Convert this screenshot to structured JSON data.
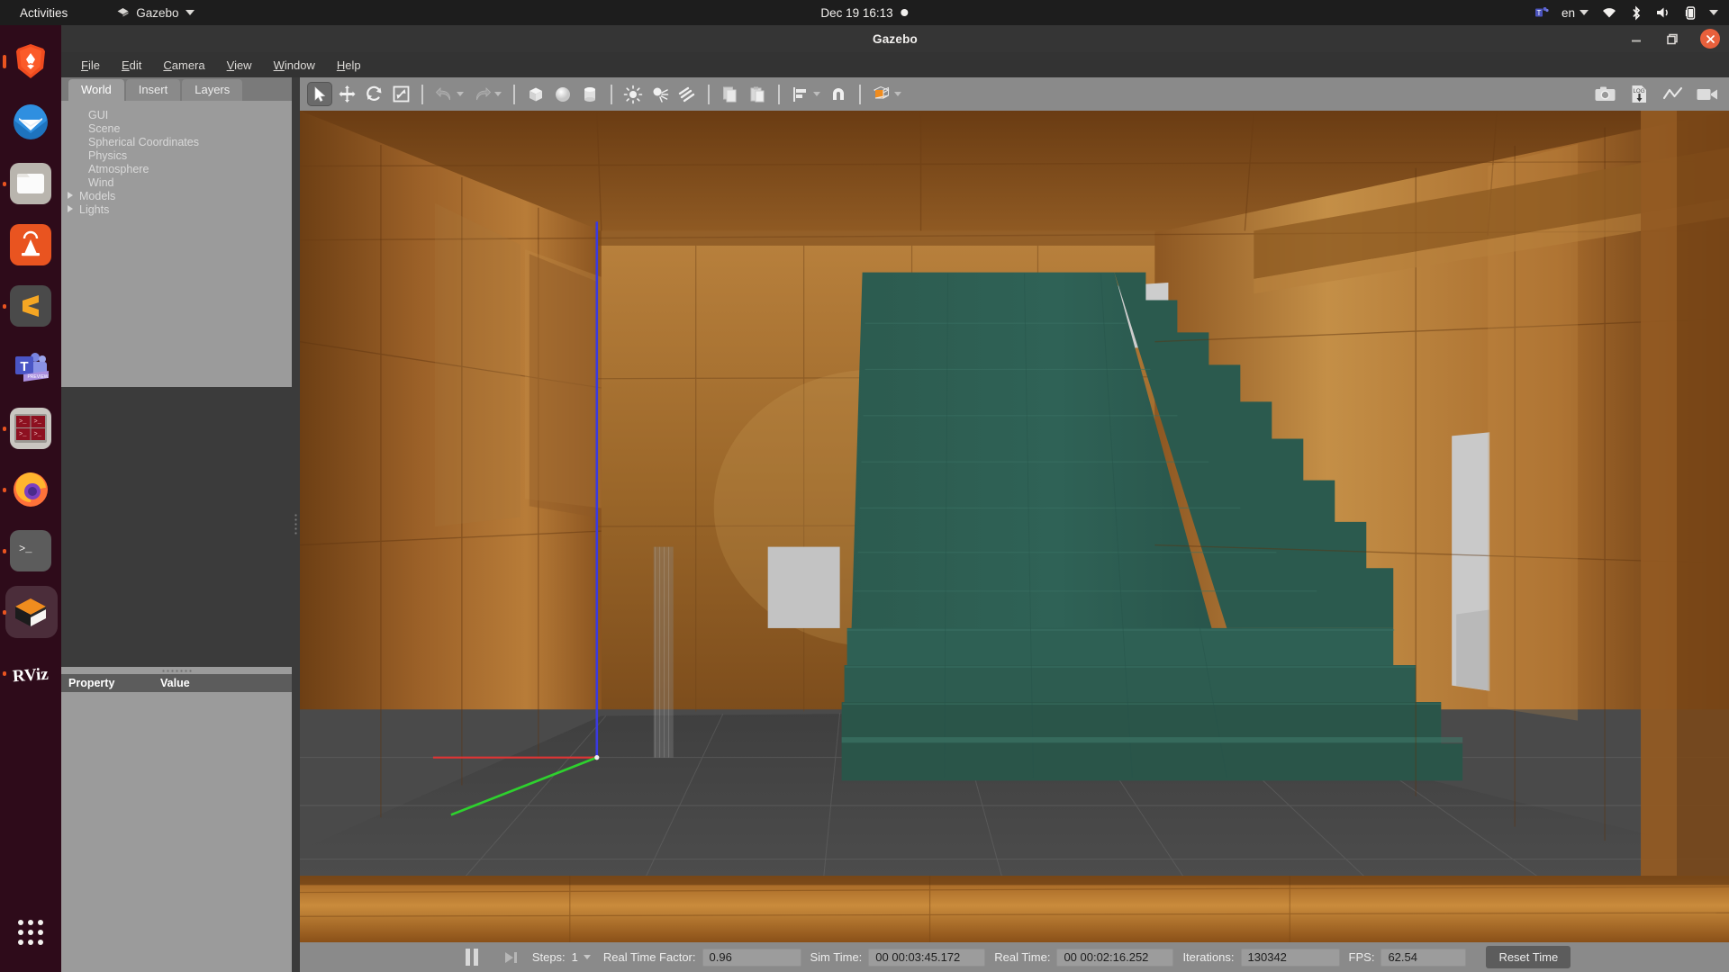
{
  "topbar": {
    "activities": "Activities",
    "app_name": "Gazebo",
    "app_icon": "gazebo-icon",
    "clock": "Dec 19  16:13",
    "tray": {
      "teams": "teams-icon",
      "language": "en",
      "wifi": "wifi-icon",
      "bluetooth": "bluetooth-icon",
      "volume": "volume-icon",
      "battery": "battery-icon",
      "menu": "chevron-down-icon"
    }
  },
  "dock": {
    "items": [
      {
        "name": "brave",
        "label": "Brave Browser",
        "running": true,
        "active": false
      },
      {
        "name": "thunderbird",
        "label": "Thunderbird Mail",
        "running": false,
        "active": false
      },
      {
        "name": "files",
        "label": "Files",
        "running": true,
        "active": false
      },
      {
        "name": "software",
        "label": "Ubuntu Software",
        "running": false,
        "active": false
      },
      {
        "name": "sublime",
        "label": "Sublime Text",
        "running": true,
        "active": false
      },
      {
        "name": "teams",
        "label": "Microsoft Teams",
        "running": false,
        "active": false
      },
      {
        "name": "terminator",
        "label": "Terminator",
        "running": true,
        "active": false
      },
      {
        "name": "firefox",
        "label": "Firefox",
        "running": true,
        "active": false
      },
      {
        "name": "terminal",
        "label": "Terminal",
        "running": true,
        "active": false
      },
      {
        "name": "gazebo",
        "label": "Gazebo",
        "running": true,
        "active": true
      },
      {
        "name": "rviz",
        "label": "RViz",
        "running": true,
        "active": false
      }
    ],
    "show_apps": "show-applications"
  },
  "window": {
    "title": "Gazebo",
    "controls": {
      "minimize": "minimize",
      "maximize": "maximize",
      "close": "close"
    }
  },
  "menubar": {
    "items": [
      {
        "pre": "",
        "mn": "F",
        "post": "ile"
      },
      {
        "pre": "",
        "mn": "E",
        "post": "dit"
      },
      {
        "pre": "",
        "mn": "C",
        "post": "amera"
      },
      {
        "pre": "",
        "mn": "V",
        "post": "iew"
      },
      {
        "pre": "",
        "mn": "W",
        "post": "indow"
      },
      {
        "pre": "",
        "mn": "H",
        "post": "elp"
      }
    ]
  },
  "left_panel": {
    "tabs": [
      {
        "label": "World",
        "active": true
      },
      {
        "label": "Insert",
        "active": false
      },
      {
        "label": "Layers",
        "active": false
      }
    ],
    "tree": [
      {
        "label": "GUI",
        "expandable": false
      },
      {
        "label": "Scene",
        "expandable": false
      },
      {
        "label": "Spherical Coordinates",
        "expandable": false
      },
      {
        "label": "Physics",
        "expandable": false
      },
      {
        "label": "Atmosphere",
        "expandable": false
      },
      {
        "label": "Wind",
        "expandable": false
      },
      {
        "label": "Models",
        "expandable": true
      },
      {
        "label": "Lights",
        "expandable": true
      }
    ],
    "property_table": {
      "col_property": "Property",
      "col_value": "Value",
      "rows": []
    }
  },
  "toolbar": {
    "left_tools": [
      {
        "name": "select-mode",
        "icon": "cursor-arrow-icon",
        "pressed": true
      },
      {
        "name": "translate-mode",
        "icon": "move-arrows-icon",
        "pressed": false
      },
      {
        "name": "rotate-mode",
        "icon": "rotate-icon",
        "pressed": false
      },
      {
        "name": "scale-mode",
        "icon": "scale-icon",
        "pressed": false
      }
    ],
    "history_tools": [
      {
        "name": "undo",
        "icon": "undo-arrow-icon",
        "has_dropdown": true
      },
      {
        "name": "redo",
        "icon": "redo-arrow-icon",
        "has_dropdown": true
      }
    ],
    "shape_tools": [
      {
        "name": "insert-box",
        "icon": "box-icon"
      },
      {
        "name": "insert-sphere",
        "icon": "sphere-icon"
      },
      {
        "name": "insert-cylinder",
        "icon": "cylinder-icon"
      }
    ],
    "light_tools": [
      {
        "name": "insert-point-light",
        "icon": "point-light-icon"
      },
      {
        "name": "insert-spot-light",
        "icon": "spot-light-icon"
      },
      {
        "name": "insert-directional-light",
        "icon": "directional-light-icon"
      }
    ],
    "clipboard_tools": [
      {
        "name": "copy",
        "icon": "copy-icon"
      },
      {
        "name": "paste",
        "icon": "paste-icon"
      }
    ],
    "align_tools": [
      {
        "name": "align",
        "icon": "align-icon",
        "has_dropdown": true
      },
      {
        "name": "snap",
        "icon": "magnet-snap-icon",
        "has_dropdown": false
      }
    ],
    "view_tools": [
      {
        "name": "view-angle",
        "icon": "view-angle-cube-icon",
        "has_dropdown": true
      }
    ],
    "right_tools": [
      {
        "name": "screenshot",
        "icon": "camera-icon"
      },
      {
        "name": "log-record",
        "icon": "log-download-icon"
      },
      {
        "name": "plot",
        "icon": "plot-line-icon"
      },
      {
        "name": "video-record",
        "icon": "video-camera-icon"
      }
    ]
  },
  "statusbar": {
    "pause_button": "pause-simulation",
    "step_button": "step-simulation",
    "steps_label": "Steps:",
    "steps_value": "1",
    "rtf_label": "Real Time Factor:",
    "rtf_value": "0.96",
    "simtime_label": "Sim Time:",
    "simtime_value": "00 00:03:45.172",
    "realtime_label": "Real Time:",
    "realtime_value": "00 00:02:16.252",
    "iterations_label": "Iterations:",
    "iterations_value": "130342",
    "fps_label": "FPS:",
    "fps_value": "62.54",
    "reset_label": "Reset Time"
  },
  "scene": {
    "description": "Gazebo 3D viewport showing an indoor wooden-panelled hallway with a teal-green staircase on the right",
    "colors": {
      "staircase": "#2f5f53",
      "wood_wall": "#a06a31",
      "floor": "#4a4a4a",
      "axis_x": "#e03434",
      "axis_y": "#2ed12e",
      "axis_z": "#3a3ae0"
    }
  }
}
